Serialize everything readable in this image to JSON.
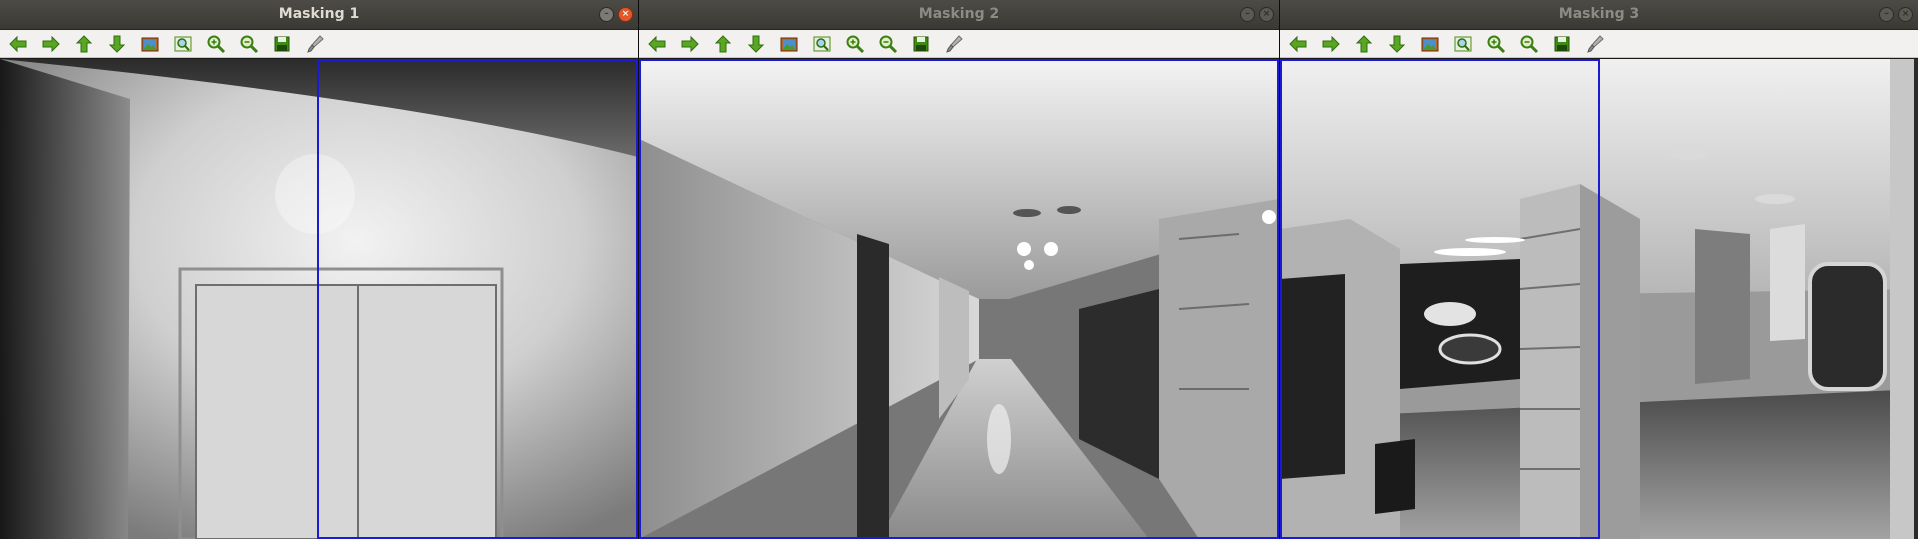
{
  "windows": [
    {
      "title": "Masking 1",
      "active": true
    },
    {
      "title": "Masking 2",
      "active": false
    },
    {
      "title": "Masking 3",
      "active": false
    }
  ],
  "window_buttons": {
    "minimize_glyph": "–",
    "close_glyph": "×"
  },
  "toolbar_icons": [
    "arrow-left-icon",
    "arrow-right-icon",
    "arrow-up-icon",
    "arrow-down-icon",
    "image-icon",
    "zoom-fit-icon",
    "zoom-in-icon",
    "zoom-out-icon",
    "save-icon",
    "brush-icon"
  ],
  "colors": {
    "roi_border": "#1b1bd6",
    "toolbar_icon_green": "#4d9a1c",
    "titlebar": "#3c3b37",
    "close_button": "#e25a2b"
  }
}
